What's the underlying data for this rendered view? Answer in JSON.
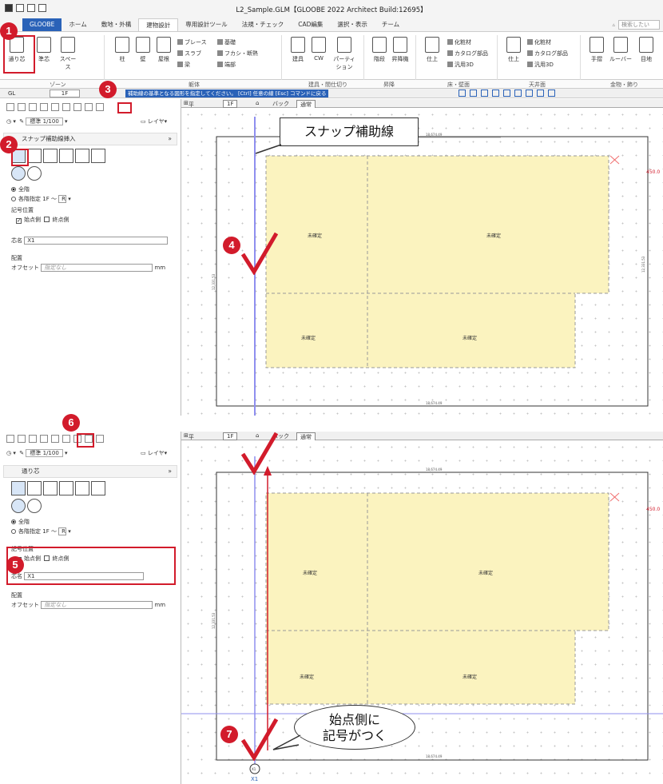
{
  "window": {
    "title": "L2_Sample.GLM【GLOOBE 2022 Architect Build:12695】"
  },
  "tabs": [
    "GLOOBE",
    "ホーム",
    "敷地・外構",
    "建物設計",
    "専用設計ツール",
    "法規・チェック",
    "CAD編集",
    "選択・表示",
    "チーム"
  ],
  "search_placeholder": "検索したい",
  "ribbon": {
    "buttons": [
      "通り芯",
      "準芯",
      "スペース",
      "柱",
      "壁",
      "屋根",
      "建具",
      "CW",
      "パーティション",
      "階段",
      "昇降機",
      "仕上",
      "仕上",
      "手摺",
      "ルーバー",
      "目地"
    ],
    "small_items": [
      "ブレース",
      "基礎",
      "スラブ",
      "フカシ・断熱",
      "梁",
      "端部",
      "化粧材",
      "カタログ部品",
      "汎用3D",
      "化粧材",
      "カタログ部品",
      "汎用3D"
    ],
    "groups": [
      "ゾーン",
      "躯体",
      "建具・間仕切り",
      "昇降",
      "床・壁面",
      "天井面",
      "金物・飾り"
    ]
  },
  "cmdbar": {
    "gl": "GL",
    "floor": "1F",
    "guide": "補助線の基準となる図形を指定してください。 [Ctrl] 任意の線 [Esc] コマンドに戻る"
  },
  "toolbar": {
    "scale": "標準 1/100",
    "layer": "レイヤ"
  },
  "view": {
    "plan": "平面",
    "floor": "1F",
    "back": "バック",
    "mode": "通常"
  },
  "panel1": {
    "section_title": "スナップ補助線挿入",
    "floors_all": "全階",
    "floors_each": "各階指定",
    "floor_from": "1F",
    "floor_to": "R",
    "symbol_label": "記号位置",
    "start_side": "始点側",
    "end_side": "終点側",
    "core_name_label": "芯名",
    "core_name": "X1",
    "placement_label": "配置",
    "offset_label": "オフセット",
    "offset_placeholder": "指定なし",
    "offset_unit": "mm"
  },
  "panel2": {
    "section_title": "通り芯",
    "floors_all": "全階",
    "floors_each": "各階指定",
    "floor_from": "1F",
    "floor_to": "R",
    "symbol_label": "記号位置",
    "start_side": "始点側",
    "end_side": "終点側",
    "core_name_label": "芯名",
    "core_name": "X1",
    "placement_label": "配置",
    "offset_label": "オフセット",
    "offset_placeholder": "指定なし",
    "offset_unit": "mm"
  },
  "drawing": {
    "dim_top": "18,674.49",
    "dim_bottom": "18,674.49",
    "dim_side": "12,331.53",
    "dim_right": "450.0",
    "room_label": "未確定",
    "axis_label": "X1"
  },
  "annotations": {
    "steps": [
      "1",
      "2",
      "3",
      "4",
      "5",
      "6",
      "7"
    ],
    "callout_snap": "スナップ補助線",
    "callout_symbol": [
      "始点側に",
      "記号がつく"
    ]
  },
  "colors": {
    "accent": "#2a62b8",
    "marker": "#d21b2b",
    "room": "#fbf3bf",
    "guide": "#8f8fef"
  }
}
